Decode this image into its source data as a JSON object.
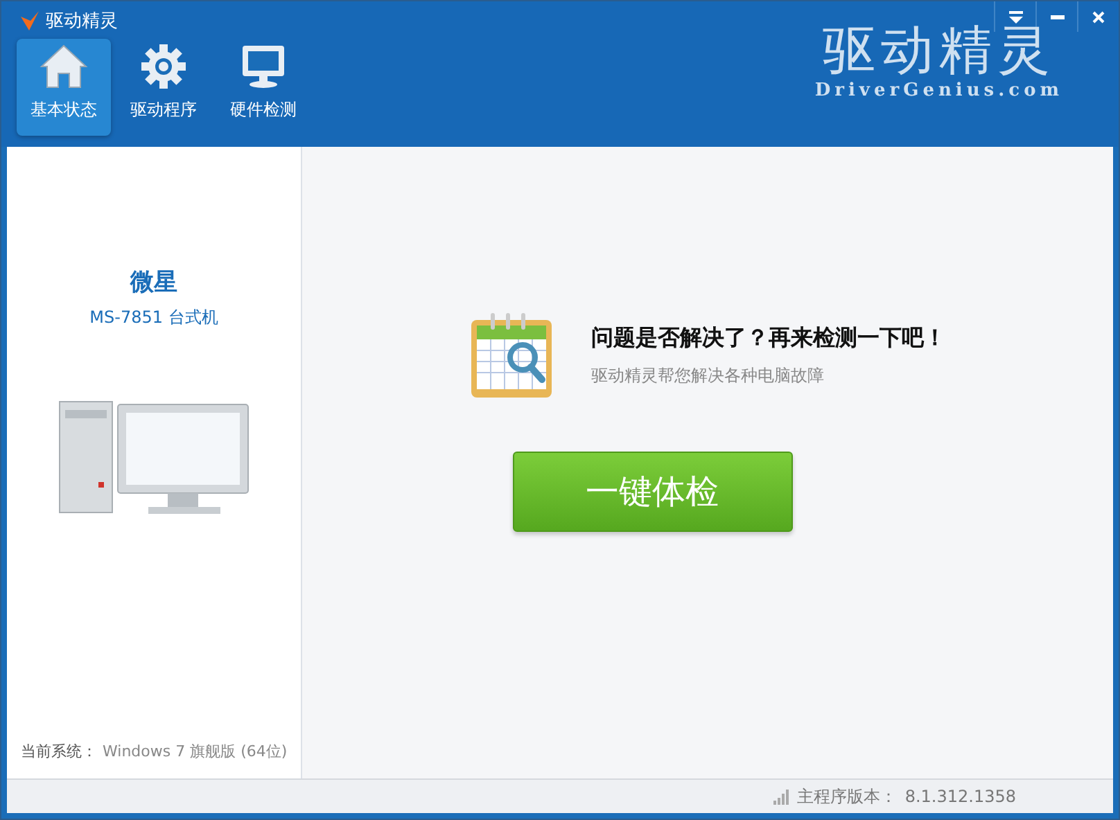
{
  "window": {
    "title": "驱动精灵"
  },
  "tabs": [
    {
      "label": "基本状态",
      "kind": "home",
      "selected": true
    },
    {
      "label": "驱动程序",
      "kind": "gear",
      "selected": false
    },
    {
      "label": "硬件检测",
      "kind": "monitor",
      "selected": false
    }
  ],
  "brand": {
    "logo": "驱动精灵",
    "site": "DriverGenius.com"
  },
  "device": {
    "brand": "微星",
    "model": "MS-7851 台式机"
  },
  "system": {
    "label": "当前系统：",
    "value": "Windows 7 旗舰版 (64位)"
  },
  "main": {
    "headline": "问题是否解决了？再来检测一下吧！",
    "subtitle": "驱动精灵帮您解决各种电脑故障",
    "button": "一键体检"
  },
  "status_bar": {
    "label": "主程序版本：",
    "version": "8.1.312.1358"
  }
}
